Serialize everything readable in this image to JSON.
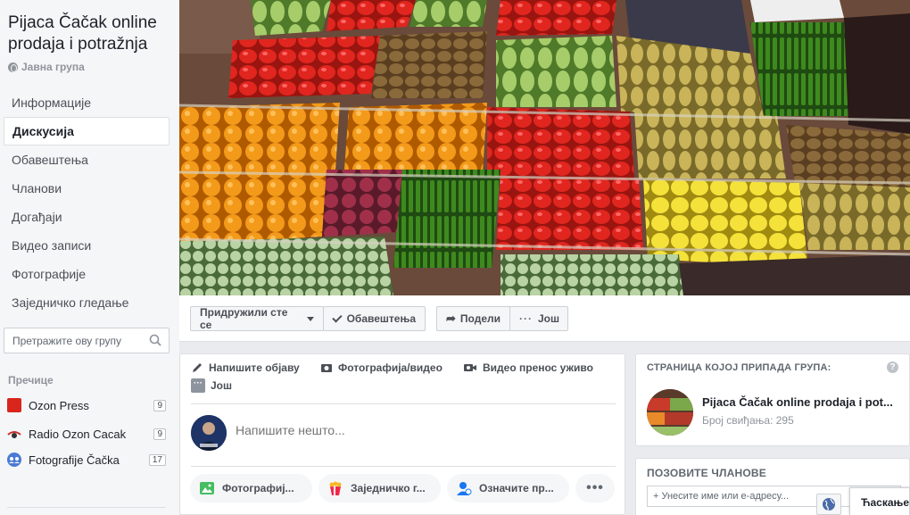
{
  "sidebar": {
    "group_title": "Pijaca Čačak online prodaja i potražnja",
    "group_type": "Јавна група",
    "nav": [
      {
        "label": "Информације"
      },
      {
        "label": "Дискусија"
      },
      {
        "label": "Обавештења"
      },
      {
        "label": "Чланови"
      },
      {
        "label": "Догађаји"
      },
      {
        "label": "Видео записи"
      },
      {
        "label": "Фотографије"
      },
      {
        "label": "Заједничко гледање"
      }
    ],
    "search_placeholder": "Претражите ову групу",
    "shortcuts_title": "Пречице",
    "shortcuts": [
      {
        "label": "Ozon Press",
        "count": "9"
      },
      {
        "label": "Radio Ozon Cacak",
        "count": "9"
      },
      {
        "label": "Fotografije Čačka",
        "count": "17"
      }
    ]
  },
  "action_bar": {
    "joined_label": "Придружили сте се",
    "notifications_label": "Обавештења",
    "share_label": "Подели",
    "more_label": "Још"
  },
  "composer": {
    "tabs": {
      "write_post": "Напишите објаву",
      "photo_video": "Фотографија/видео",
      "live_video": "Видео пренос уживо",
      "more": "Још"
    },
    "placeholder": "Напишите нешто...",
    "pills": {
      "photo": "Фотографиј...",
      "watch_party": "Заједничко г...",
      "tag": "Означите пр..."
    }
  },
  "right": {
    "page_card_title": "СТРАНИЦА КОЈОЈ ПРИПАДА ГРУПА:",
    "page_name": "Pijaca Čačak online prodaja i pot...",
    "page_likes": "Број свиђања: 295",
    "invite_title": "ПОЗОВИТЕ ЧЛАНОВЕ",
    "invite_placeholder": "+ Унесите име или е-адресу..."
  },
  "chat": {
    "label": "Ћаскање"
  },
  "colors": {
    "accent": "#4267b2",
    "sidebar_bg": "#f5f6f7",
    "page_bg": "#e9ebee"
  }
}
